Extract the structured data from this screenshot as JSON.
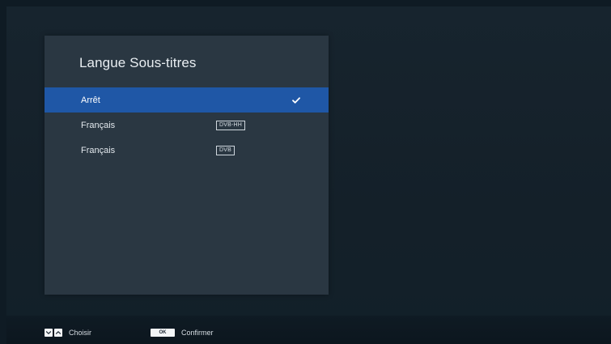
{
  "dialog": {
    "title": "Langue Sous-titres",
    "options": [
      {
        "label": "Arrêt",
        "tag": "",
        "selected": true,
        "checked": true
      },
      {
        "label": "Français",
        "tag": "DVB-HH",
        "selected": false,
        "checked": false
      },
      {
        "label": "Français",
        "tag": "DVB",
        "selected": false,
        "checked": false
      }
    ]
  },
  "footer": {
    "choose_label": "Choisir",
    "ok_key_label": "OK",
    "confirm_label": "Confirmer"
  },
  "icons": {
    "checked": "check-icon",
    "down": "chevron-down-icon",
    "up": "chevron-up-icon"
  },
  "colors": {
    "background": "#0f1b24",
    "panel": "#2a3742",
    "selection": "#1f57a6",
    "text": "#e2e8ed"
  }
}
